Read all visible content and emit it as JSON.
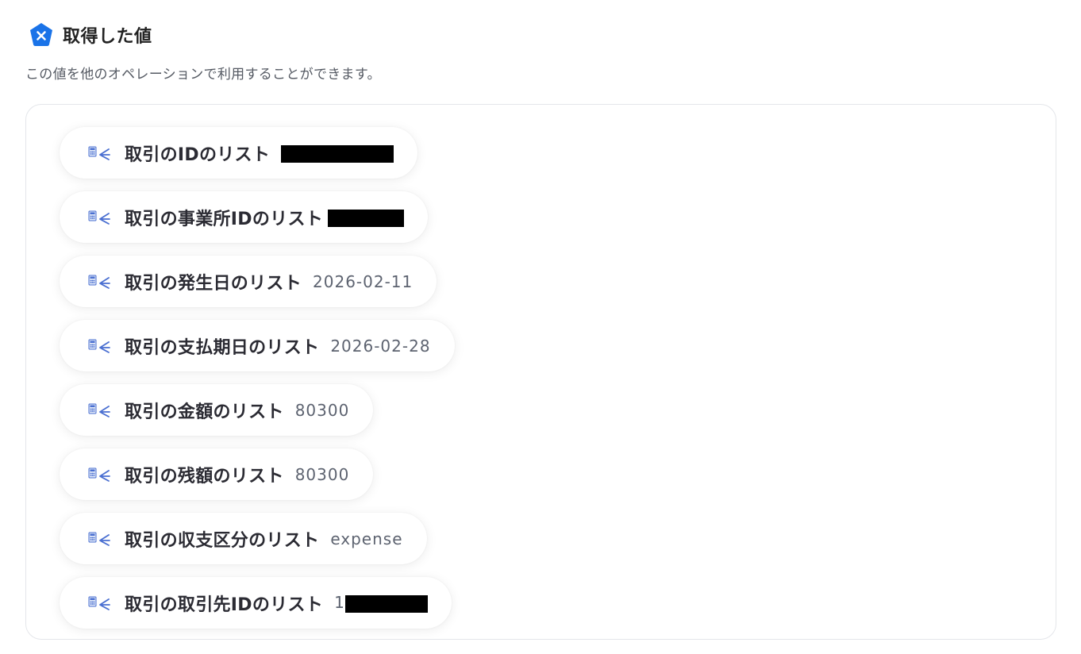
{
  "header": {
    "logo_icon": "blue-pentagon-x-icon",
    "title": "取得した値",
    "description": "この値を他のオペレーションで利用することができます。"
  },
  "values": [
    {
      "label": "取引のIDのリスト",
      "value": "",
      "redacted": true,
      "icon": "calculator-arrow-icon"
    },
    {
      "label": "取引の事業所IDのリスト",
      "value": "",
      "redacted": true,
      "icon": "calculator-arrow-icon"
    },
    {
      "label": "取引の発生日のリスト",
      "value": "2026-02-11",
      "icon": "calculator-arrow-icon"
    },
    {
      "label": "取引の支払期日のリスト",
      "value": "2026-02-28",
      "icon": "calculator-arrow-icon"
    },
    {
      "label": "取引の金額のリスト",
      "value": "80300",
      "icon": "calculator-arrow-icon"
    },
    {
      "label": "取引の残額のリスト",
      "value": "80300",
      "icon": "calculator-arrow-icon"
    },
    {
      "label": "取引の収支区分のリスト",
      "value": "expense",
      "icon": "calculator-arrow-icon"
    },
    {
      "label": "取引の取引先IDのリスト",
      "value": "1",
      "redacted": true,
      "icon": "calculator-arrow-icon"
    }
  ],
  "colors": {
    "accent": "#1a73e8",
    "text": "#2b2b33",
    "value_text": "#5d6370",
    "border": "#e4e6ea"
  }
}
